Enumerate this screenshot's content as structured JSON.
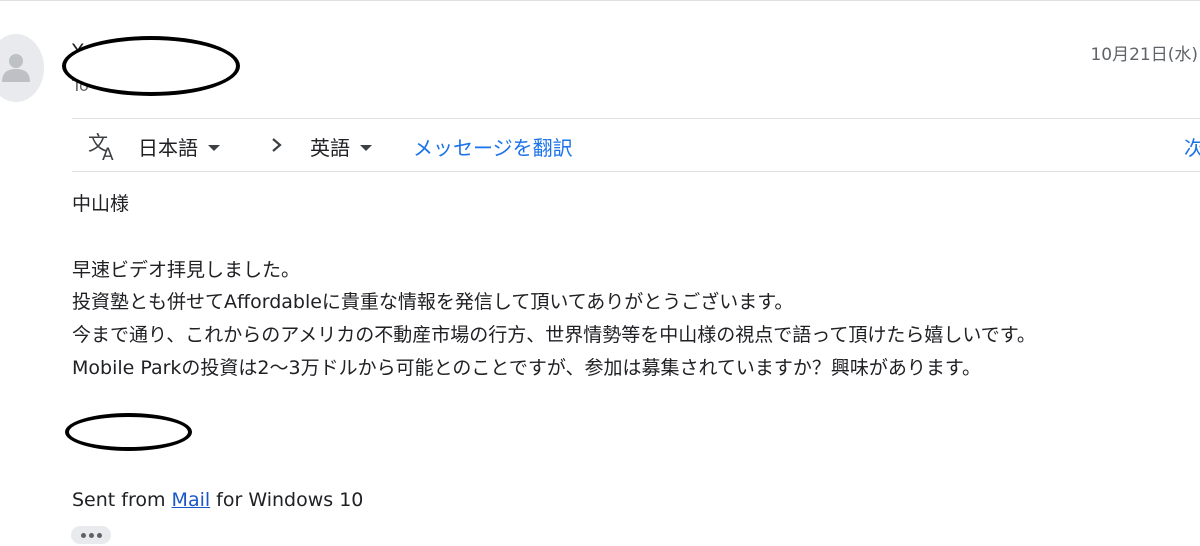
{
  "header": {
    "sender_name": "Y",
    "recipient": "To",
    "date": "10月21日(水)"
  },
  "translate_bar": {
    "source_language": "日本語",
    "target_language": "英語",
    "translate_label": "メッセージを翻訳",
    "next_label": "次"
  },
  "message": {
    "greeting": "中山様",
    "lines": [
      "早速ビデオ拝見しました。",
      "投資塾とも併せてAffordableに貴重な情報を発信して頂いてありがとうございます。",
      "今まで通り、これからのアメリカの不動産市場の行方、世界情勢等を中山様の視点で語って頂けたら嬉しいです。",
      "Mobile Parkの投資は2〜3万ドルから可能とのことですが、参加は募集されていますか？興味があります。"
    ],
    "signature": {
      "prefix": "Sent from ",
      "link_text": "Mail",
      "suffix": " for Windows 10"
    }
  },
  "colors": {
    "link": "#1a73e8",
    "text": "#202124",
    "muted": "#5f6368",
    "divider": "#e0e0e0"
  },
  "icons": {
    "avatar": "person-icon",
    "translate": "translate-icon",
    "dropdown": "caret-down-icon",
    "separator": "chevron-right-icon",
    "more": "more-horiz-icon"
  }
}
